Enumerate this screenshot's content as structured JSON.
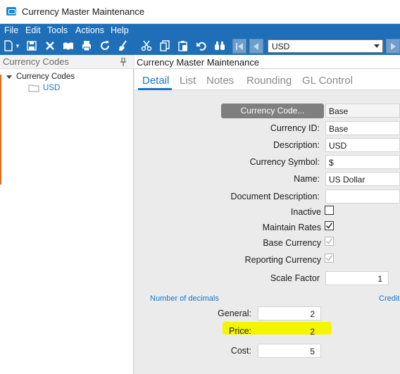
{
  "window": {
    "title": "Currency Master Maintenance"
  },
  "menu": [
    "File",
    "Edit",
    "Tools",
    "Actions",
    "Help"
  ],
  "toolbar": {
    "record_select_value": "USD"
  },
  "left_panel": {
    "header": "Currency Codes",
    "tree": {
      "root": "Currency Codes",
      "children": [
        "USD"
      ]
    }
  },
  "main": {
    "header": "Currency Master Maintenance",
    "tabs": [
      "Detail",
      "List",
      "Notes",
      "Rounding",
      "GL Control"
    ],
    "active_tab": "Detail",
    "form": {
      "currency_code_button": "Currency Code...",
      "currency_code_value": "Base",
      "currency_id_label": "Currency ID:",
      "currency_id_value": "Base",
      "description_label": "Description:",
      "description_value": "USD",
      "currency_symbol_label": "Currency Symbol:",
      "currency_symbol_value": "$",
      "name_label": "Name:",
      "name_value": "US Dollar",
      "document_description_label": "Document Description:",
      "document_description_value": "",
      "inactive_label": "Inactive",
      "inactive_checked": false,
      "maintain_rates_label": "Maintain Rates",
      "maintain_rates_checked": true,
      "base_currency_label": "Base Currency",
      "base_currency_checked": true,
      "reporting_currency_label": "Reporting Currency",
      "reporting_currency_checked": true,
      "scale_factor_label": "Scale Factor",
      "scale_factor_value": "1",
      "number_of_decimals_label": "Number of decimals",
      "credit_label": "Credit",
      "general_label": "General:",
      "general_value": "2",
      "price_label": "Price:",
      "price_value": "2",
      "cost_label": "Cost:",
      "cost_value": "5"
    }
  },
  "colors": {
    "accent": "#1e6fb8",
    "link": "#1976c8",
    "highlight": "#f5f500",
    "button": "#7f7f7f"
  }
}
